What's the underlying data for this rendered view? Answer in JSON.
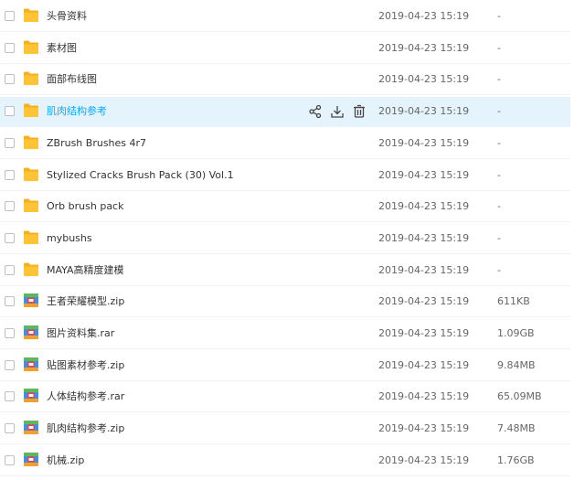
{
  "colors": {
    "folder": "#ffc436",
    "folder_tab": "#f6b01f",
    "archive_blue": "#3f8ee8",
    "archive_green": "#5cb85c",
    "archive_orange": "#f0a030",
    "archive_red": "#e8453c",
    "hover_bg": "#e5f4fc",
    "hover_text": "#09aaff"
  },
  "hover_actions": [
    {
      "name": "share-icon",
      "label": ""
    },
    {
      "name": "download-icon",
      "label": ""
    },
    {
      "name": "delete-icon",
      "label": ""
    }
  ],
  "files": [
    {
      "name": "头骨资料",
      "date": "2019-04-23 15:19",
      "size": "-",
      "type": "folder",
      "icon": "folder-icon",
      "hovered": false
    },
    {
      "name": "素材图",
      "date": "2019-04-23 15:19",
      "size": "-",
      "type": "folder",
      "icon": "folder-icon",
      "hovered": false
    },
    {
      "name": "面部布线图",
      "date": "2019-04-23 15:19",
      "size": "-",
      "type": "folder",
      "icon": "folder-icon",
      "hovered": false
    },
    {
      "name": "肌肉结构参考",
      "date": "2019-04-23 15:19",
      "size": "-",
      "type": "folder",
      "icon": "folder-icon",
      "hovered": true
    },
    {
      "name": "ZBrush Brushes 4r7",
      "date": "2019-04-23 15:19",
      "size": "-",
      "type": "folder",
      "icon": "folder-icon",
      "hovered": false
    },
    {
      "name": "Stylized Cracks Brush Pack (30) Vol.1",
      "date": "2019-04-23 15:19",
      "size": "-",
      "type": "folder",
      "icon": "folder-icon",
      "hovered": false
    },
    {
      "name": "Orb brush pack",
      "date": "2019-04-23 15:19",
      "size": "-",
      "type": "folder",
      "icon": "folder-icon",
      "hovered": false
    },
    {
      "name": "mybushs",
      "date": "2019-04-23 15:19",
      "size": "-",
      "type": "folder",
      "icon": "folder-icon",
      "hovered": false
    },
    {
      "name": "MAYA高精度建模",
      "date": "2019-04-23 15:19",
      "size": "-",
      "type": "folder",
      "icon": "folder-icon",
      "hovered": false
    },
    {
      "name": "王者荣耀模型.zip",
      "date": "2019-04-23 15:19",
      "size": "611KB",
      "type": "archive",
      "icon": "archive-icon",
      "hovered": false
    },
    {
      "name": "图片资料集.rar",
      "date": "2019-04-23 15:19",
      "size": "1.09GB",
      "type": "archive",
      "icon": "archive-icon",
      "hovered": false
    },
    {
      "name": "贴图素材参考.zip",
      "date": "2019-04-23 15:19",
      "size": "9.84MB",
      "type": "archive",
      "icon": "archive-icon",
      "hovered": false
    },
    {
      "name": "人体结构参考.rar",
      "date": "2019-04-23 15:19",
      "size": "65.09MB",
      "type": "archive",
      "icon": "archive-icon",
      "hovered": false
    },
    {
      "name": "肌肉结构参考.zip",
      "date": "2019-04-23 15:19",
      "size": "7.48MB",
      "type": "archive",
      "icon": "archive-icon",
      "hovered": false
    },
    {
      "name": "机械.zip",
      "date": "2019-04-23 15:19",
      "size": "1.76GB",
      "type": "archive",
      "icon": "archive-icon",
      "hovered": false
    }
  ]
}
